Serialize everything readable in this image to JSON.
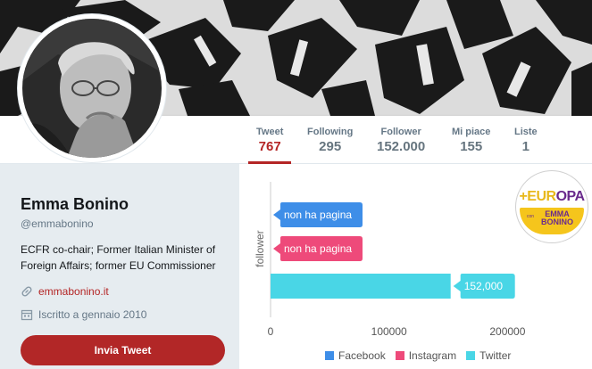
{
  "profile": {
    "name": "Emma Bonino",
    "handle": "@emmabonino",
    "bio_lines": [
      "ECFR co-chair; Former Italian Minister of",
      "Foreign Affairs; former EU Commissioner"
    ],
    "website": "emmabonino.it",
    "joined": "Iscritto a gennaio 2010",
    "tweet_button": "Invia Tweet",
    "accent_color": "#b42525"
  },
  "nav": {
    "stats": [
      {
        "label": "Tweet",
        "value": "767",
        "active": true
      },
      {
        "label": "Following",
        "value": "295",
        "active": false
      },
      {
        "label": "Follower",
        "value": "152.000",
        "active": false
      },
      {
        "label": "Mi piace",
        "value": "155",
        "active": false
      },
      {
        "label": "Liste",
        "value": "1",
        "active": false
      }
    ]
  },
  "logo": {
    "word_part1": "+EUR",
    "word_part2": "OPA",
    "con": "con",
    "line1": "EMMA",
    "line2": "BONINO"
  },
  "chart_data": {
    "type": "bar",
    "orientation": "horizontal",
    "ylabel": "follower",
    "xlim": [
      0,
      260000
    ],
    "xticks": [
      0,
      100000,
      200000
    ],
    "xtick_labels": [
      "0",
      "100000",
      "200000"
    ],
    "series": [
      {
        "name": "Facebook",
        "color": "#3e8ee8",
        "value": null,
        "label": "non ha pagina"
      },
      {
        "name": "Instagram",
        "color": "#ee4a7a",
        "value": null,
        "label": "non ha pagina"
      },
      {
        "name": "Twitter",
        "color": "#49d6e6",
        "value": 152000,
        "label": "152,000"
      }
    ],
    "legend_position": "bottom"
  }
}
